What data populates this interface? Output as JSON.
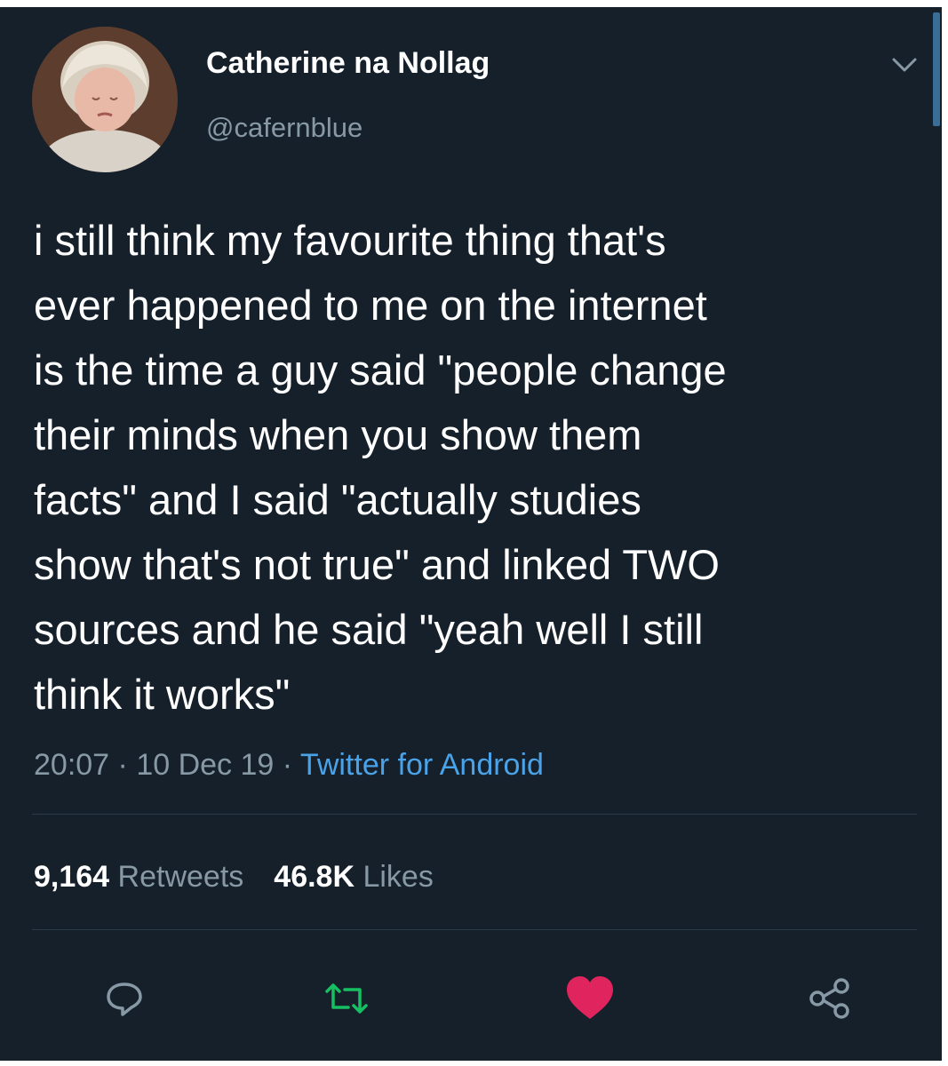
{
  "user": {
    "display_name": "Catherine na Nollag",
    "handle": "@cafernblue",
    "avatar_icon": "profile-photo"
  },
  "tweet": {
    "lines": [
      "i still think my favourite thing that's",
      "ever happened to me on the internet",
      "is the time a guy said \"people change",
      "their minds when you show them",
      "facts\" and I said \"actually studies",
      "show that's not true\" and linked TWO",
      "sources and he said \"yeah well I still",
      "think it works\""
    ]
  },
  "meta": {
    "time": "20:07",
    "separator": " · ",
    "date": "10 Dec 19",
    "source": "Twitter for Android"
  },
  "stats": {
    "retweets_count": "9,164",
    "retweets_label": "Retweets",
    "likes_count": "46.8K",
    "likes_label": "Likes"
  },
  "actions": {
    "reply_icon": "reply-icon",
    "retweet_icon": "retweet-icon",
    "like_icon": "heart-icon",
    "share_icon": "share-icon"
  },
  "colors": {
    "background": "#15202b",
    "muted_text": "#8899a6",
    "link": "#4aa2e8",
    "retweet_green": "#17bf63",
    "like_red": "#e0245e"
  }
}
